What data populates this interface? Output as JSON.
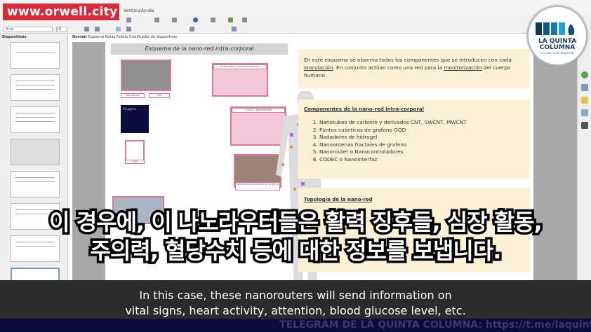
{
  "watermark": "www.orwell.city",
  "menu": {
    "items": [
      "Ventana",
      "Ayuda"
    ]
  },
  "toolbar": {
    "font_name": "Arial",
    "font_size": "18"
  },
  "slides_panel": {
    "title": "Diapositivas",
    "count": 8,
    "selected": 8
  },
  "view_tabs": [
    "Normal",
    "Esquema",
    "Notas",
    "Folleto",
    "Clasificador de diapositivas"
  ],
  "slide": {
    "title": "Esquema de la nano-red intra-corporal",
    "intro": {
      "p1": "En este esquema se observa todos los componentes que se introducen con cada ",
      "link1": "inoculación",
      "p2": ". En conjunto actúan como una red para la ",
      "link2": "monitorización",
      "p3": " del cuerpo humano"
    },
    "components": {
      "heading": "Componentes de la nano-red intra-corporal",
      "items": [
        "Nanotubos de carbono y derivados CNT, SWCNT, MWCNT",
        "Puntos cuánticos de grafeno GQD",
        "Nadadores de hidrogel",
        "Nanoantenas fractales de grafeno",
        "Nanorouter o Nanocontroladores",
        "CODEC o Nanointerfaz"
      ]
    },
    "topology": {
      "heading": "Topología de la nano-red"
    },
    "diagram_labels": {
      "nanotubes": "Nanotubos",
      "cnt": "CNT",
      "nanorouter": "Nanorouter / nanocontroladores",
      "codec": "CODEC / Nanointerfaz",
      "gqd": "GQD",
      "gqd_scale": "50 µg/mL",
      "antennas": "Nanoantenas fractales de grafeno"
    }
  },
  "logo": {
    "line1": "LA QUINTA",
    "line2": "COLUMNA",
    "tagline": "La ciencia del despertar"
  },
  "subtitles": {
    "korean": [
      "이 경우에, 이 나노라우터들은 활력 징후들, 심장 활동,",
      "주의력, 혈당수치 등에 대한 정보를 보냅니다."
    ],
    "english": [
      "In this case, these nanorouters will send information on",
      "vital signs, heart activity, attention, blood glucose level, etc."
    ]
  },
  "ticker": "TELEGRAM DE LA QUINTA COLUMNA: https://t.me/laquintacolumna"
}
